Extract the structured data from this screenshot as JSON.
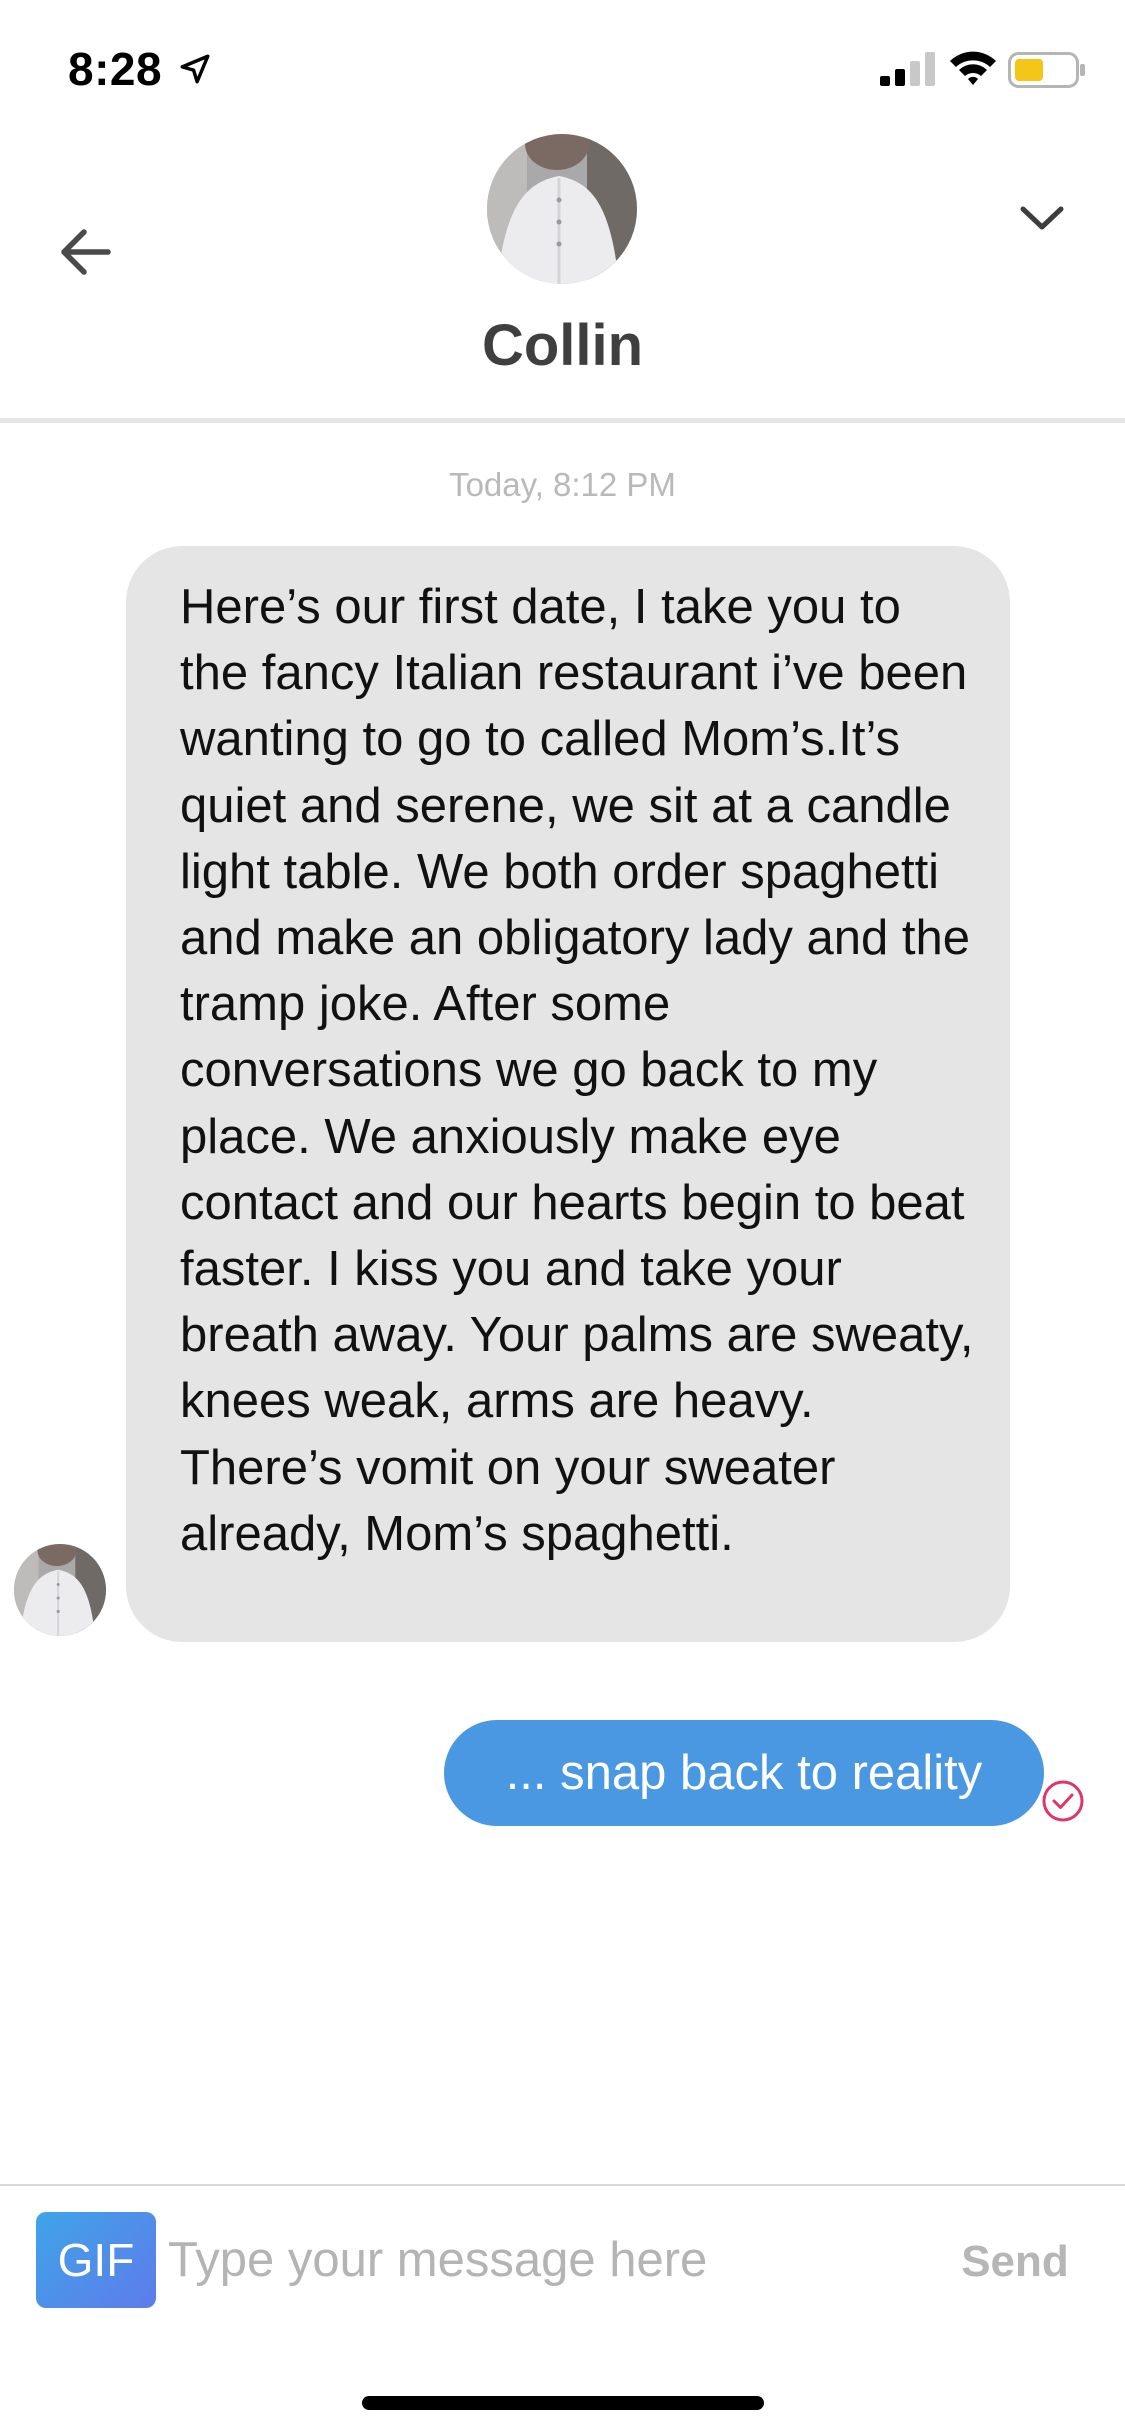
{
  "status_bar": {
    "time": "8:28",
    "icons": [
      "location-arrow-icon",
      "cellular-signal-icon",
      "wifi-icon",
      "battery-icon"
    ],
    "battery_color": "#f5c518"
  },
  "header": {
    "contact_name": "Collin",
    "back_icon": "arrow-left-icon",
    "collapse_icon": "chevron-down-icon"
  },
  "conversation": {
    "timestamp": "Today, 8:12 PM",
    "messages": [
      {
        "direction": "incoming",
        "text": "Here’s our first date, I take you to the fancy Italian restaurant i’ve been wanting to go to called Mom’s.It’s quiet and serene, we sit at a candle light table. We both order spaghetti and make an obligatory lady and the tramp joke. After some conversations we go back to my place. We anxiously make eye contact and our hearts begin to beat faster. I kiss you and take your breath away. Your palms are sweaty, knees weak, arms are heavy. There’s vomit on your sweater already, Mom’s spaghetti."
      },
      {
        "direction": "outgoing",
        "text": "... snap back to reality",
        "status_icon": "check-circle-icon"
      }
    ]
  },
  "composer": {
    "gif_label": "GIF",
    "placeholder": "Type your message here",
    "value": "",
    "send_label": "Send"
  },
  "colors": {
    "incoming_bubble": "#e5e5e5",
    "outgoing_bubble": "#4a97e2",
    "read_receipt": "#e0346b",
    "send_disabled": "#b6b6b6"
  }
}
